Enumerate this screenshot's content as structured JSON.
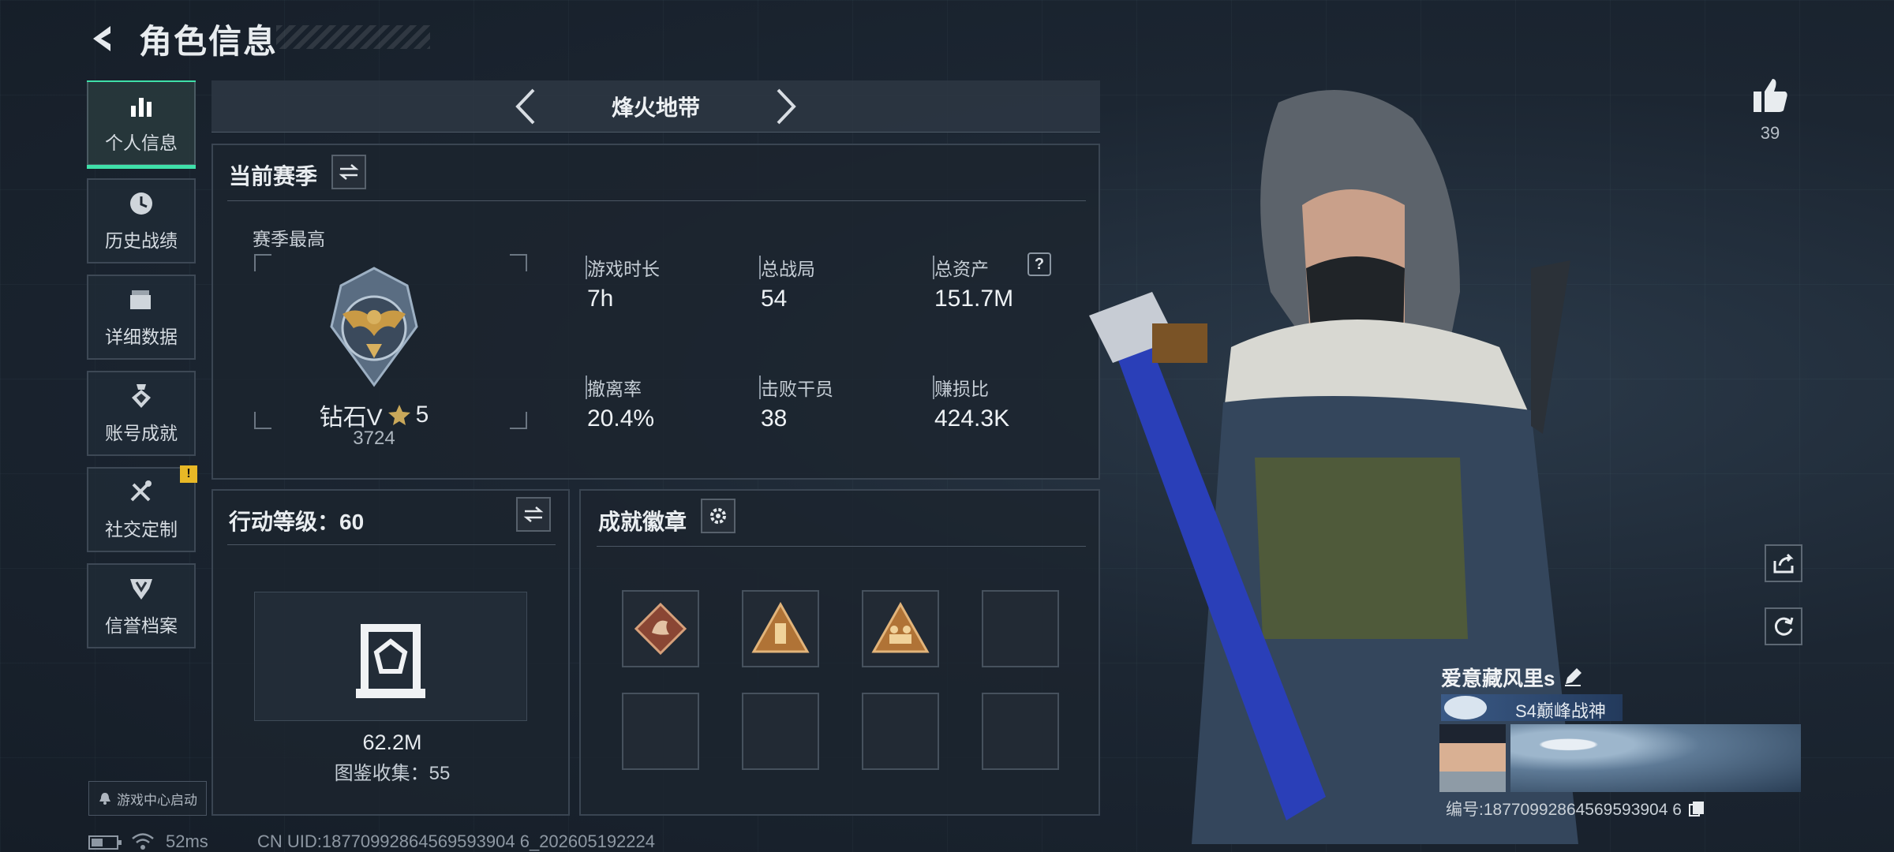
{
  "header": {
    "title": "角色信息"
  },
  "sidebar": {
    "items": [
      {
        "label": "个人信息"
      },
      {
        "label": "历史战绩"
      },
      {
        "label": "详细数据"
      },
      {
        "label": "账号成就"
      },
      {
        "label": "社交定制",
        "badge": "!"
      },
      {
        "label": "信誉档案"
      }
    ],
    "game_center_label": "游戏中心启动"
  },
  "mode": {
    "title": "烽火地带"
  },
  "season": {
    "title": "当前赛季",
    "best_label": "赛季最高",
    "rank_text": "钻石V",
    "rank_stars": "5",
    "rank_score": "3724",
    "stats": [
      {
        "label": "游戏时长",
        "value": "7h"
      },
      {
        "label": "总战局",
        "value": "54"
      },
      {
        "label": "总资产",
        "value": "151.7M",
        "help": "?"
      },
      {
        "label": "撤离率",
        "value": "20.4%"
      },
      {
        "label": "击败干员",
        "value": "38"
      },
      {
        "label": "赚损比",
        "value": "424.3K"
      }
    ]
  },
  "action_level": {
    "title": "行动等级：60",
    "value": "62.2M",
    "collection": "图鉴收集：55"
  },
  "achievements": {
    "title": "成就徽章"
  },
  "profile": {
    "likes": "39",
    "name": "爱意藏风里s",
    "title_badge": "S4巅峰战神",
    "id_text": "编号:18770992864569593904 6"
  },
  "status": {
    "ping": "52ms",
    "uid": "CN UID:18770992864569593904 6_202605192224"
  },
  "colors": {
    "accent": "#3fe0a9",
    "warn": "#e8b826",
    "bg": "#1a2330"
  }
}
